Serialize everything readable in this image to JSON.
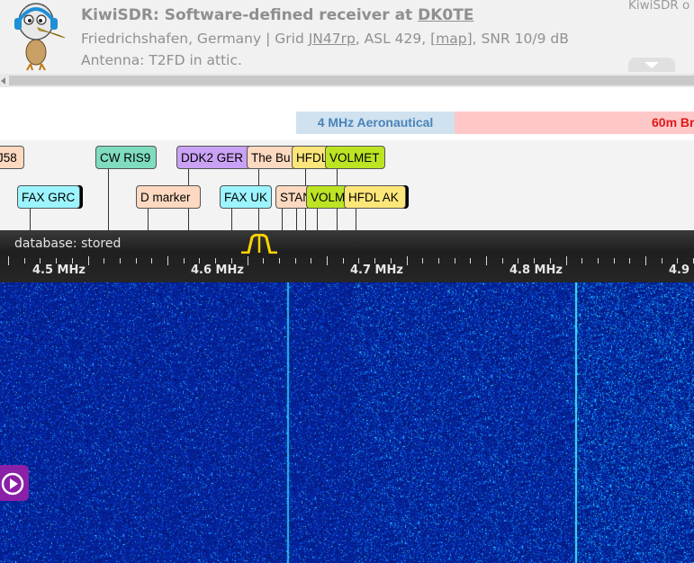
{
  "header": {
    "title_prefix": "KiwiSDR: Software-defined receiver at ",
    "title_callsign": "DK0TE",
    "location": "Friedrichshafen, Germany | Grid ",
    "grid": "JN47rp",
    "asl": ", ASL 429, ",
    "map_link": "[map]",
    "snr": ", SNR 10/9 dB",
    "antenna": "Antenna: T2FD in attic.",
    "corner_text": "KiwiSDR o",
    "logo_icon": "kiwi-bird-headphones-logo"
  },
  "bands": {
    "aeronautical": "4 MHz Aeronautical",
    "sixty_m": "60m Br"
  },
  "labels": {
    "j58": "J58",
    "cw_ris9": "CW RIS9",
    "ddk2": "DDK2 GER",
    "the_bu": "The Bu",
    "hfdl1": "HFDL",
    "volmet1": "VOLMET",
    "fax_grc": "FAX GRC",
    "d_marker": "D marker",
    "fax_uk": "FAX UK",
    "stan": "STAN",
    "volm2": "VOLM",
    "hfdl_ak": "HFDL AK"
  },
  "label_colors": {
    "peach": "#fcd9c0",
    "teal": "#7fdcbf",
    "purple": "#c9a2f5",
    "yellow": "#fde679",
    "green": "#bce423",
    "cyan": "#9cf4ff"
  },
  "scale": {
    "database": "database: stored",
    "freqs": [
      "4.5 MHz",
      "4.6 MHz",
      "4.7 MHz",
      "4.8 MHz",
      "4.9"
    ]
  },
  "waterfall": {
    "background": "#071a7c",
    "play_icon": "play-circle-icon"
  }
}
